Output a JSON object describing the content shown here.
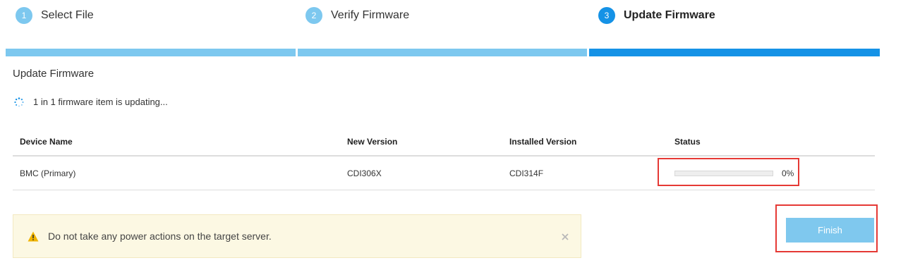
{
  "steps": [
    {
      "number": "1",
      "label": "Select File",
      "state": "done"
    },
    {
      "number": "2",
      "label": "Verify Firmware",
      "state": "done"
    },
    {
      "number": "3",
      "label": "Update Firmware",
      "state": "active"
    }
  ],
  "section_title": "Update Firmware",
  "progress_message": "1 in 1 firmware item is updating...",
  "table": {
    "headers": [
      "Device Name",
      "New Version",
      "Installed Version",
      "Status"
    ],
    "rows": [
      {
        "device": "BMC (Primary)",
        "new_version": "CDI306X",
        "installed_version": "CDI314F",
        "progress_fraction": 0,
        "status_text": "0%"
      }
    ]
  },
  "warning": {
    "text": "Do not take any power actions on the target server.",
    "icon": "warning-triangle-icon",
    "close_icon": "close-icon"
  },
  "finish_label": "Finish",
  "colors": {
    "step_done": "#7dc8ef",
    "step_active": "#1592e6",
    "highlight": "#e53935",
    "warning_bg": "#fcf8e3",
    "warning_icon": "#f0b400",
    "finish_button": "#7fc8ee"
  }
}
